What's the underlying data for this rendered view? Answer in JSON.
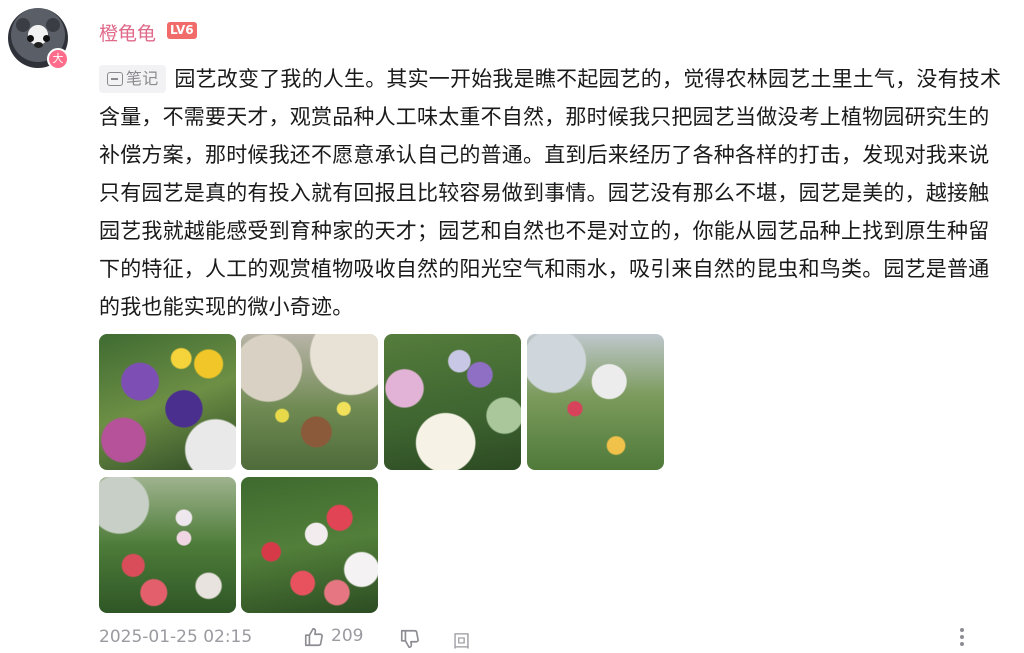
{
  "user": {
    "name": "橙龟龟",
    "level": "LV6",
    "avatar_badge": "大"
  },
  "post": {
    "tag_label": "笔记",
    "text": "园艺改变了我的人生。其实一开始我是瞧不起园艺的，觉得农林园艺土里土气，没有技术含量，不需要天才，观赏品种人工味太重不自然，那时候我只把园艺当做没考上植物园研究生的补偿方案，那时候我还不愿意承认自己的普通。直到后来经历了各种各样的打击，发现对我来说只有园艺是真的有投入就有回报且比较容易做到事情。园艺没有那么不堪，园艺是美的，越接触园艺我就越能感受到育种家的天才；园艺和自然也不是对立的，你能从园艺品种上找到原生种留下的特征，人工的观赏植物吸收自然的阳光空气和雨水，吸引来自然的昆虫和鸟类。园艺是普通的我也能实现的微小奇迹。",
    "images": [
      {
        "icon": "photo-pansies-purple-yellow"
      },
      {
        "icon": "photo-balcony-garden"
      },
      {
        "icon": "photo-pink-white-flowers"
      },
      {
        "icon": "photo-rooftop-garden"
      },
      {
        "icon": "photo-lupines-poppies"
      },
      {
        "icon": "photo-red-white-poppies"
      }
    ]
  },
  "footer": {
    "timestamp": "2025-01-25 02:15",
    "likes": "209",
    "reply_label": "回复"
  },
  "colors": {
    "username": "#e06a8a",
    "level_badge": "#f26b6b",
    "meta_text": "#9a9aa0"
  }
}
